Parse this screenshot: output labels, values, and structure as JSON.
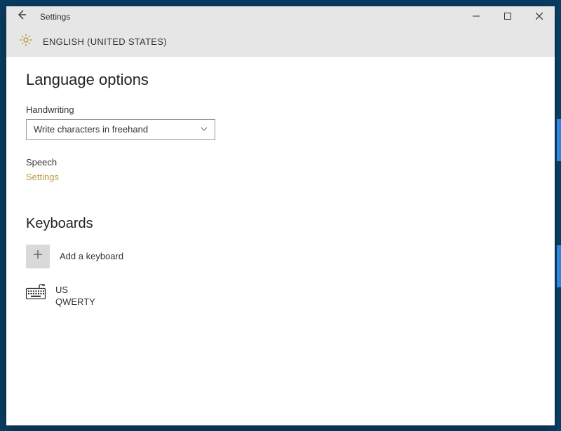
{
  "titlebar": {
    "title": "Settings"
  },
  "subtitle": "ENGLISH (UNITED STATES)",
  "main": {
    "heading": "Language options",
    "handwriting": {
      "label": "Handwriting",
      "selected": "Write characters in freehand"
    },
    "speech": {
      "label": "Speech",
      "link": "Settings"
    }
  },
  "keyboards": {
    "heading": "Keyboards",
    "add_label": "Add a keyboard",
    "items": [
      {
        "name": "US",
        "layout": "QWERTY"
      }
    ]
  }
}
